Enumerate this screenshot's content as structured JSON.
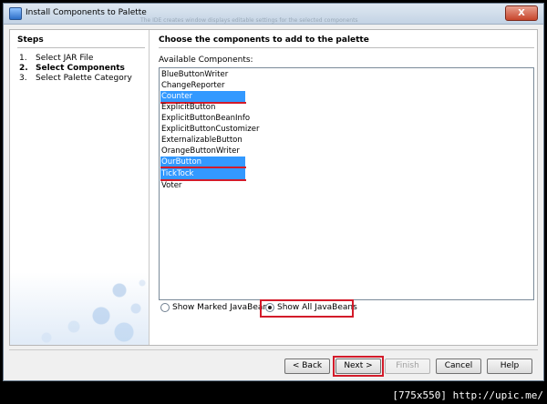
{
  "window": {
    "title": "Install Components to Palette",
    "title_ghost_text": "The IDE creates window displays editable settings for the selected components",
    "close_glyph": "X"
  },
  "sidebar": {
    "title": "Steps",
    "steps": [
      {
        "num": "1.",
        "label": "Select JAR File"
      },
      {
        "num": "2.",
        "label": "Select Components"
      },
      {
        "num": "3.",
        "label": "Select Palette Category"
      }
    ],
    "current_step": 2
  },
  "main": {
    "title": "Choose the components to add to the palette",
    "available_label": "Available Components:",
    "components": [
      {
        "label": "BlueButtonWriter",
        "selected": false
      },
      {
        "label": "ChangeReporter",
        "selected": false
      },
      {
        "label": "Counter",
        "selected": true
      },
      {
        "label": "ExplicitButton",
        "selected": false
      },
      {
        "label": "ExplicitButtonBeanInfo",
        "selected": false
      },
      {
        "label": "ExplicitButtonCustomizer",
        "selected": false
      },
      {
        "label": "ExternalizableButton",
        "selected": false
      },
      {
        "label": "OrangeButtonWriter",
        "selected": false
      },
      {
        "label": "OurButton",
        "selected": true
      },
      {
        "label": "TickTock",
        "selected": true
      },
      {
        "label": "Voter",
        "selected": false
      }
    ],
    "radio_options": [
      {
        "label": "Show Marked JavaBeans",
        "checked": false
      },
      {
        "label": "Show All JavaBeans",
        "checked": true
      }
    ]
  },
  "buttons": {
    "back": "< Back",
    "next": "Next >",
    "finish": "Finish",
    "cancel": "Cancel",
    "help": "Help"
  },
  "watermark": "[775x550] http://upic.me/",
  "colors": {
    "selection": "#3399ff",
    "annotation_red": "#d31b2a"
  }
}
